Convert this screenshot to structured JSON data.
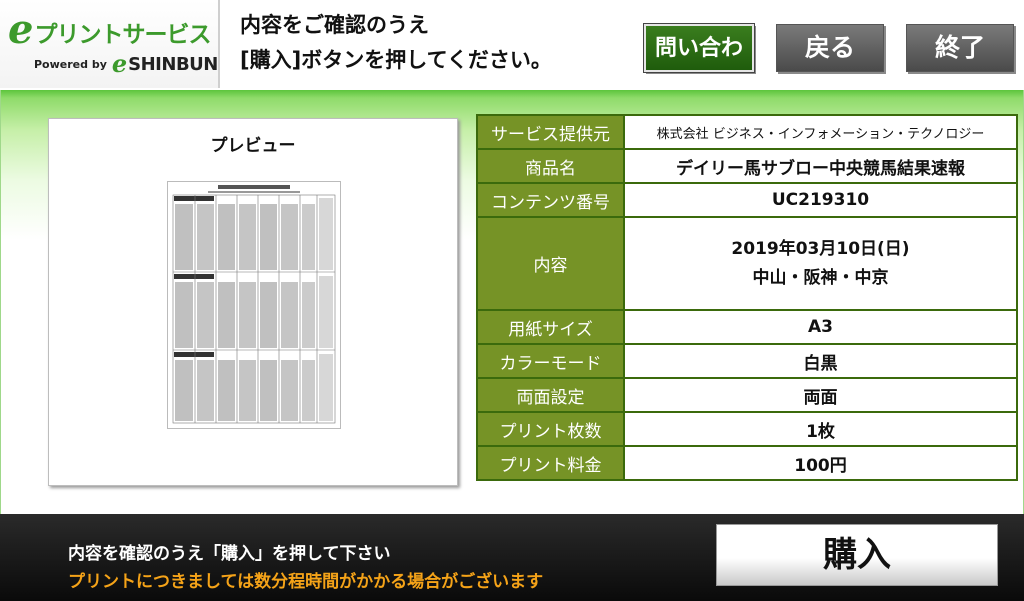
{
  "header": {
    "logo": {
      "e": "e",
      "name": "プリントサービス",
      "powered_by": "Powered by",
      "e2": "e",
      "brand": "SHINBUN"
    },
    "instruction_line1": "内容をご確認のうえ",
    "instruction_line2": "[購入]ボタンを押してください。",
    "inquiry_label": "問い合わせ",
    "back_label": "戻る",
    "end_label": "終了"
  },
  "preview": {
    "title": "プレビュー"
  },
  "details": [
    {
      "label": "サービス提供元",
      "value": "株式会社 ビジネス・インフォメーション・テクノロジー"
    },
    {
      "label": "商品名",
      "value": "デイリー馬サブロー中央競馬結果速報"
    },
    {
      "label": "コンテンツ番号",
      "value": "UC219310"
    },
    {
      "label": "内容",
      "value_line1": "2019年03月10日(日)",
      "value_line2": "中山・阪神・中京"
    },
    {
      "label": "用紙サイズ",
      "value": "A3"
    },
    {
      "label": "カラーモード",
      "value": "白黒"
    },
    {
      "label": "両面設定",
      "value": "両面"
    },
    {
      "label": "プリント枚数",
      "value": "1枚"
    },
    {
      "label": "プリント料金",
      "value": "100円"
    }
  ],
  "footer": {
    "message": "内容を確認のうえ「購入」を押して下さい",
    "notice": "プリントにつきましては数分程時間がかかる場合がございます",
    "buy_label": "購入"
  },
  "colors": {
    "brand_green": "#3c9a2c",
    "label_bg": "#769326",
    "table_border": "#3b6a0c",
    "notice_orange": "#f5a318"
  }
}
